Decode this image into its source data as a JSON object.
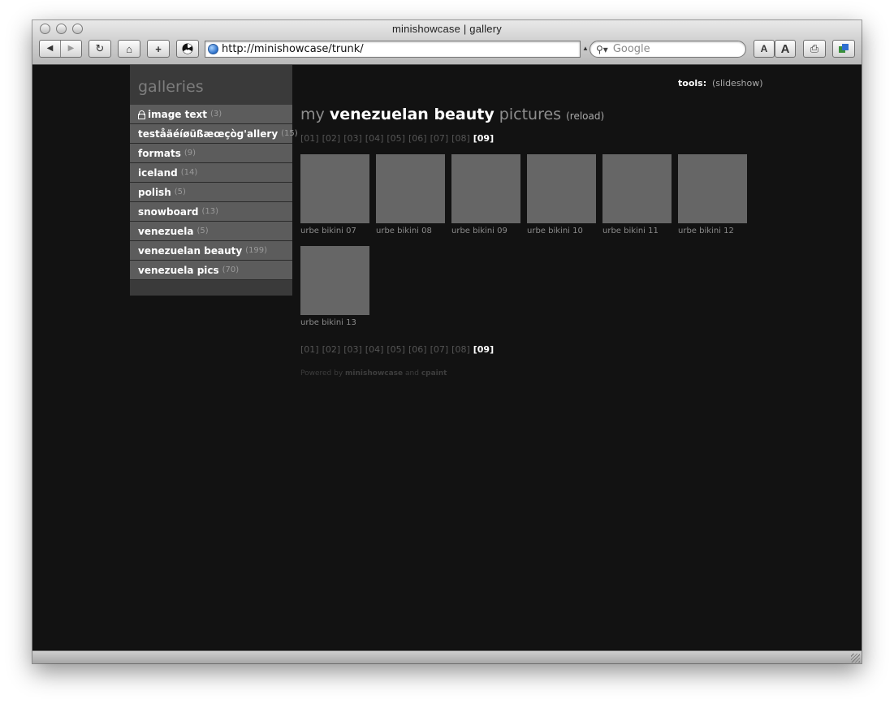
{
  "window": {
    "title": "minishowcase | gallery",
    "url": "http://minishowcase/trunk/",
    "search_placeholder": "Google",
    "toolbar": {
      "back_icon": "◀",
      "forward_icon": "▶",
      "reload_icon": "↻",
      "home_icon": "⌂",
      "add_bookmark_icon": "+",
      "text_smaller": "A",
      "text_bigger": "A",
      "print_icon": "⎙"
    }
  },
  "sidebar": {
    "title": "galleries",
    "items": [
      {
        "label": "image text",
        "count": "(3)",
        "locked": true
      },
      {
        "label": "teståäéíøüßæœçòg'allery",
        "count": "(15)"
      },
      {
        "label": "formats",
        "count": "(9)"
      },
      {
        "label": "iceland",
        "count": "(14)"
      },
      {
        "label": "polish",
        "count": "(5)"
      },
      {
        "label": "snowboard",
        "count": "(13)"
      },
      {
        "label": "venezuela",
        "count": "(5)"
      },
      {
        "label": "venezuelan beauty",
        "count": "(199)"
      },
      {
        "label": "venezuela pics",
        "count": "(70)"
      }
    ]
  },
  "tools": {
    "label": "tools:",
    "slideshow": "(slideshow)"
  },
  "heading": {
    "prefix": "my",
    "gallery": "venezuelan beauty",
    "suffix": "pictures",
    "reload": "(reload)"
  },
  "pager": {
    "pages": [
      "[01]",
      "[02]",
      "[03]",
      "[04]",
      "[05]",
      "[06]",
      "[07]",
      "[08]"
    ],
    "current": "[09]"
  },
  "thumbnails": [
    {
      "caption": "urbe bikini 07"
    },
    {
      "caption": "urbe bikini 08"
    },
    {
      "caption": "urbe bikini 09"
    },
    {
      "caption": "urbe bikini 10"
    },
    {
      "caption": "urbe bikini 11"
    },
    {
      "caption": "urbe bikini 12"
    },
    {
      "caption": "urbe bikini 13"
    }
  ],
  "footer": {
    "powered_by": "Powered by",
    "app": "minishowcase",
    "and": "and",
    "author": "cpaint"
  },
  "colors": {
    "page_bg": "#121212",
    "sidebar_item_bg": "#5c5c5c",
    "thumb_bg": "#666666"
  }
}
